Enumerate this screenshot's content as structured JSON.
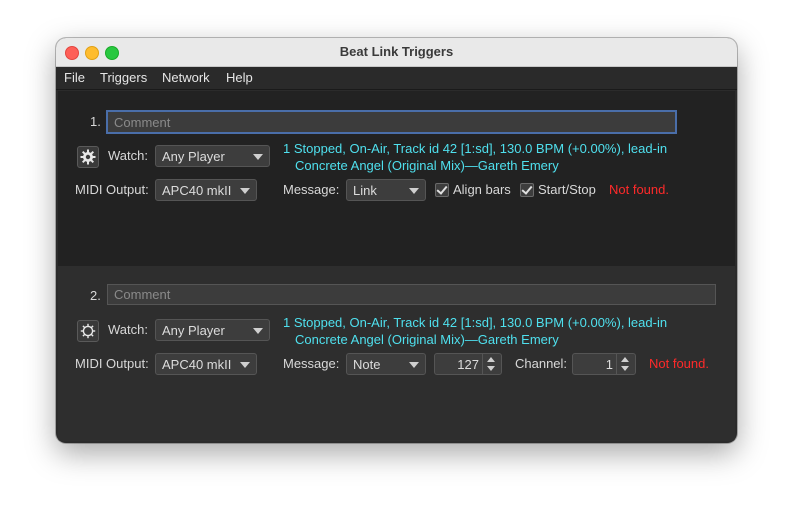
{
  "window": {
    "title": "Beat Link Triggers"
  },
  "menu": [
    "File",
    "Triggers",
    "Network",
    "Help"
  ],
  "triggers": [
    {
      "index": "1.",
      "comment_placeholder": "Comment",
      "watch_label": "Watch:",
      "watch_value": "Any Player",
      "status_line1": "1 Stopped, On-Air, Track id 42 [1:sd], 130.0 BPM (+0.00%), lead-in",
      "status_line2": "Concrete Angel (Original Mix)—Gareth Emery",
      "midi_label": "MIDI Output:",
      "midi_value": "APC40 mkII",
      "message_label": "Message:",
      "message_value": "Link",
      "align_bars_label": "Align bars",
      "align_bars_checked": true,
      "start_stop_label": "Start/Stop",
      "start_stop_checked": true,
      "error": "Not found."
    },
    {
      "index": "2.",
      "comment_placeholder": "Comment",
      "watch_label": "Watch:",
      "watch_value": "Any Player",
      "status_line1": "1 Stopped, On-Air, Track id 42 [1:sd], 130.0 BPM (+0.00%), lead-in",
      "status_line2": "Concrete Angel (Original Mix)—Gareth Emery",
      "midi_label": "MIDI Output:",
      "midi_value": "APC40 mkII",
      "message_label": "Message:",
      "message_value": "Note",
      "note_value": "127",
      "channel_label": "Channel:",
      "channel_value": "1",
      "error": "Not found."
    }
  ],
  "colors": {
    "status": "#4fe0ee",
    "error": "#ff2a2a",
    "focus": "#4a6ea9"
  }
}
